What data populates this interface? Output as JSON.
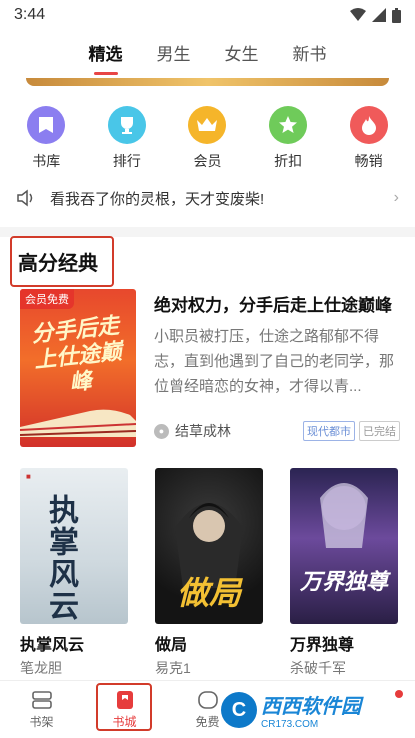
{
  "status": {
    "time": "3:44"
  },
  "top_tabs": [
    {
      "label": "精选",
      "active": true
    },
    {
      "label": "男生",
      "active": false
    },
    {
      "label": "女生",
      "active": false
    },
    {
      "label": "新书",
      "active": false
    }
  ],
  "quick_nav": [
    {
      "label": "书库",
      "icon": "library-icon",
      "color": "#8b7ef0"
    },
    {
      "label": "排行",
      "icon": "trophy-icon",
      "color": "#49c6e8"
    },
    {
      "label": "会员",
      "icon": "crown-icon",
      "color": "#f5b52a"
    },
    {
      "label": "折扣",
      "icon": "star-icon",
      "color": "#6fcb5a"
    },
    {
      "label": "畅销",
      "icon": "flame-icon",
      "color": "#f05a5a"
    }
  ],
  "notice": {
    "text": "看我吞了你的灵根，天才变废柴!",
    "icon": "speaker-icon"
  },
  "section": {
    "title": "高分经典"
  },
  "featured": {
    "badge": "会员免费",
    "cover_title": "分手后走上仕途巅峰",
    "title": "绝对权力，分手后走上仕途巅峰",
    "description": "小职员被打压，仕途之路郁郁不得志，直到他遇到了自己的老同学，那位曾经暗恋的女神，才得以青...",
    "author": "结草成林",
    "tags": [
      "现代都市",
      "已完结"
    ]
  },
  "books": [
    {
      "title": "执掌风云",
      "author": "笔龙胆",
      "cover_text": "执掌风云"
    },
    {
      "title": "做局",
      "author": "易克1",
      "cover_text": "做局"
    },
    {
      "title": "万界独尊",
      "author": "杀破千军",
      "cover_text": "万界独尊"
    }
  ],
  "bottom_nav": [
    {
      "label": "书架",
      "icon": "bookshelf-icon"
    },
    {
      "label": "书城",
      "icon": "bookstore-icon",
      "active": true
    },
    {
      "label": "免费",
      "icon": "free-icon"
    },
    {
      "label": "",
      "icon": "discover-icon"
    },
    {
      "label": "",
      "icon": "profile-icon"
    }
  ],
  "watermark": {
    "text": "西西软件园",
    "sub": "CR173.COM"
  }
}
